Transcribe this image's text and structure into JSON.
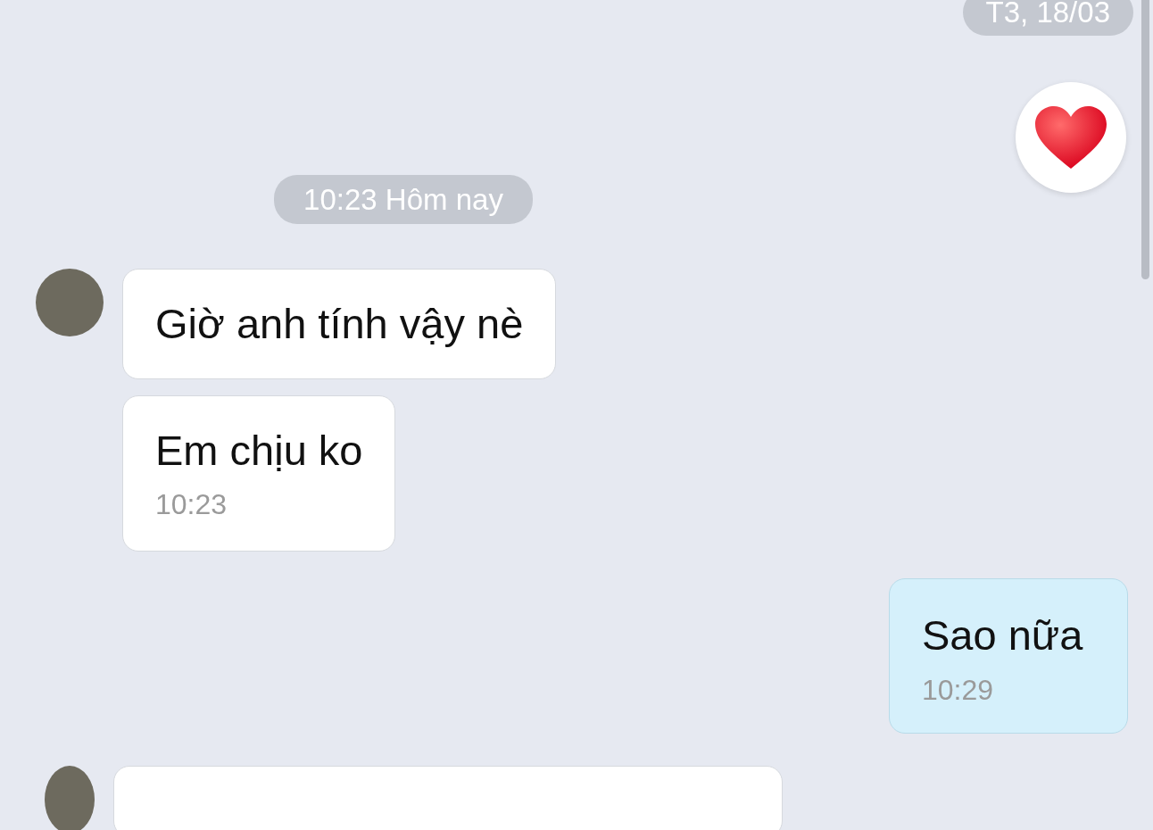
{
  "top_date": "T3, 18/03",
  "messages": [
    {
      "kind": "reaction"
    },
    {
      "kind": "divider",
      "text": "10:23 Hôm nay"
    },
    {
      "kind": "incoming",
      "avatar": true,
      "text": "Giờ anh tính vậy nè"
    },
    {
      "kind": "incoming",
      "avatar": false,
      "text": "Em chịu ko",
      "time": "10:23"
    },
    {
      "kind": "outgoing",
      "text": "Sao nữa",
      "time": "10:29"
    },
    {
      "kind": "incoming",
      "avatar": true,
      "cut": true
    }
  ]
}
